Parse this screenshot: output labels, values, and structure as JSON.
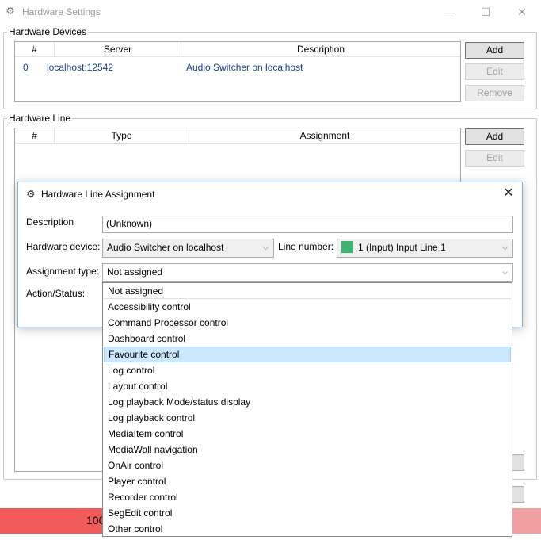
{
  "window": {
    "title": "Hardware Settings",
    "minimize_glyph": "—",
    "maximize_glyph": "☐",
    "close_glyph": "✕"
  },
  "hardware_devices": {
    "legend": "Hardware Devices",
    "columns": [
      "#",
      "Server",
      "Description"
    ],
    "rows": [
      {
        "index": "0",
        "server": "localhost:12542",
        "description": "Audio Switcher on localhost"
      }
    ],
    "buttons": {
      "add": "Add",
      "edit": "Edit",
      "remove": "Remove"
    }
  },
  "hardware_line": {
    "legend": "Hardware Line",
    "columns": [
      "#",
      "Type",
      "Assignment"
    ],
    "buttons": {
      "add": "Add",
      "edit": "Edit"
    }
  },
  "background": {
    "status_fragment": "100"
  },
  "dialog": {
    "title": "Hardware Line Assignment",
    "close_glyph": "✕",
    "description_label": "Description",
    "description_value": "(Unknown)",
    "hardware_device_label": "Hardware device:",
    "hardware_device_value": "Audio Switcher on localhost",
    "line_number_label": "Line number:",
    "line_number_value": "1 (Input) Input Line 1",
    "line_color": "#3cb371",
    "assignment_type_label": "Assignment type:",
    "assignment_type_value": "Not assigned",
    "action_status_label": "Action/Status:"
  },
  "dropdown": {
    "items": [
      "Not assigned",
      "Accessibility control",
      "Command Processor control",
      "Dashboard control",
      "Favourite control",
      "Log control",
      "Layout control",
      "Log playback Mode/status display",
      "Log playback control",
      "MediaItem control",
      "MediaWall navigation",
      "OnAir control",
      "Player control",
      "Recorder control",
      "SegEdit control",
      "Other control"
    ],
    "highlighted": "Favourite control"
  },
  "colors": {
    "accent_border": "#7ab0d8",
    "highlight": "#cce8ff",
    "status_red": "#f35b5b"
  }
}
